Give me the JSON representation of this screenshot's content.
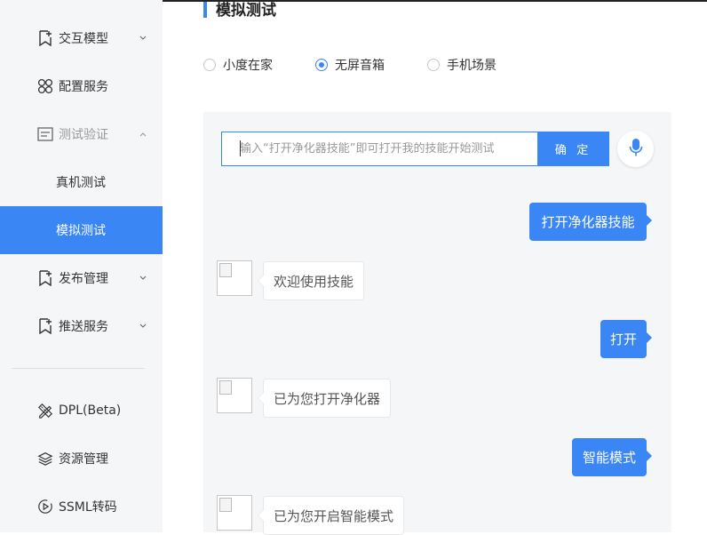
{
  "sidebar": {
    "items": [
      {
        "label": "交互模型",
        "icon": "bookmark-plus-icon",
        "expanded": false
      },
      {
        "label": "配置服务",
        "icon": "clover-grid-icon"
      },
      {
        "label": "测试验证",
        "icon": "document-icon",
        "expanded": true
      },
      {
        "label": "真机测试"
      },
      {
        "label": "模拟测试",
        "active": true
      },
      {
        "label": "发布管理",
        "icon": "bookmark-plus-icon",
        "expanded": false
      },
      {
        "label": "推送服务",
        "icon": "bookmark-plus-icon",
        "expanded": false
      },
      {
        "label": "DPL(Beta)",
        "icon": "pencil-ruler-icon"
      },
      {
        "label": "资源管理",
        "icon": "layers-icon"
      },
      {
        "label": "SSML转码",
        "icon": "play-circle-icon"
      }
    ]
  },
  "main": {
    "title": "模拟测试",
    "device_options": [
      {
        "label": "小度在家",
        "selected": false
      },
      {
        "label": "无屏音箱",
        "selected": true
      },
      {
        "label": "手机场景",
        "selected": false
      }
    ],
    "input": {
      "placeholder": "输入“打开净化器技能”即可打开我的技能开始测试",
      "value": ""
    },
    "confirm_label": "确 定",
    "mic_icon": "microphone-icon",
    "messages": [
      {
        "from": "user",
        "text": "打开净化器技能"
      },
      {
        "from": "bot",
        "text": "欢迎使用技能"
      },
      {
        "from": "user",
        "text": "打开"
      },
      {
        "from": "bot",
        "text": "已为您打开净化器"
      },
      {
        "from": "user",
        "text": "智能模式"
      },
      {
        "from": "bot",
        "text": "已为您开启智能模式"
      }
    ]
  },
  "colors": {
    "accent": "#3a86f5",
    "sidebar_bg": "#f5f6f8",
    "panel_bg": "#f5f6f8"
  }
}
